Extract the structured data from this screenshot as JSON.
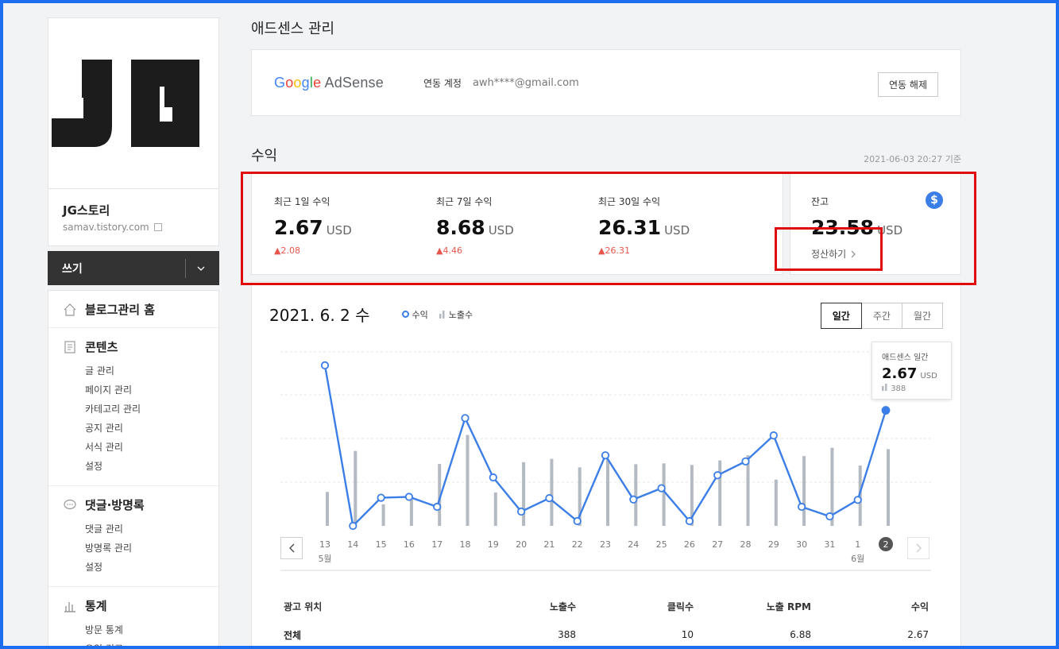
{
  "sidebar": {
    "logo_text": "JG",
    "blog_name": "JG스토리",
    "blog_url": "samav.tistory.com",
    "write_label": "쓰기",
    "sections": [
      {
        "title": "블로그관리 홈",
        "items": []
      },
      {
        "title": "콘텐츠",
        "items": [
          "글 관리",
          "페이지 관리",
          "카테고리 관리",
          "공지 관리",
          "서식 관리",
          "설정"
        ]
      },
      {
        "title": "댓글·방명록",
        "items": [
          "댓글 관리",
          "방명록 관리",
          "설정"
        ]
      },
      {
        "title": "통계",
        "items": [
          "방문 통계",
          "유입 경로"
        ]
      }
    ]
  },
  "adsense": {
    "section_title": "애드센스 관리",
    "logo_google": "Google",
    "logo_adsense": "AdSense",
    "linked_label": "연동 계정",
    "email": "awh****@gmail.com",
    "unlink_button": "연동 해제"
  },
  "earnings": {
    "section_title": "수익",
    "timestamp": "2021-06-03 20:27 기준",
    "stats": [
      {
        "title": "최근 1일 수익",
        "value": "2.67",
        "unit": "USD",
        "change": "2.08"
      },
      {
        "title": "최근 7일 수익",
        "value": "8.68",
        "unit": "USD",
        "change": "4.46"
      },
      {
        "title": "최근 30일 수익",
        "value": "26.31",
        "unit": "USD",
        "change": "26.31"
      }
    ],
    "balance": {
      "title": "잔고",
      "value": "23.58",
      "unit": "USD",
      "settle_label": "정산하기",
      "icon": "dollar-icon"
    }
  },
  "chart_panel": {
    "date": "2021. 6. 2 수",
    "legend_revenue": "수익",
    "legend_impressions": "노출수",
    "tabs": [
      "일간",
      "주간",
      "월간"
    ],
    "active_tab": "일간",
    "tooltip": {
      "title": "애드센스 일간",
      "value": "2.67",
      "unit": "USD",
      "impressions": "388"
    },
    "month_labels": [
      {
        "at": "13",
        "label": "5월"
      },
      {
        "at": "1",
        "label": "6월"
      }
    ],
    "selected_day": "2"
  },
  "chart_data": {
    "type": "line",
    "x": [
      "13",
      "14",
      "15",
      "16",
      "17",
      "18",
      "19",
      "20",
      "21",
      "22",
      "23",
      "24",
      "25",
      "26",
      "27",
      "28",
      "29",
      "30",
      "31",
      "1",
      "2"
    ],
    "series": [
      {
        "name": "수익",
        "values": [
          3.71,
          0.0,
          0.65,
          0.67,
          0.44,
          2.49,
          1.12,
          0.33,
          0.64,
          0.11,
          1.63,
          0.61,
          0.87,
          0.11,
          1.17,
          1.49,
          2.09,
          0.44,
          0.22,
          0.6,
          2.67
        ]
      },
      {
        "name": "노출수",
        "values": [
          172,
          379,
          109,
          134,
          313,
          460,
          169,
          322,
          339,
          296,
          336,
          312,
          316,
          308,
          331,
          357,
          234,
          353,
          395,
          305,
          388
        ]
      }
    ],
    "colors": {
      "revenue": "#3c7ee8",
      "impressions": "#b4bac1"
    },
    "grid": true
  },
  "table": {
    "headers": [
      "광고 위치",
      "노출수",
      "클릭수",
      "노출 RPM",
      "수익"
    ],
    "rows": [
      [
        "전체",
        "388",
        "10",
        "6.88",
        "2.67"
      ]
    ]
  }
}
